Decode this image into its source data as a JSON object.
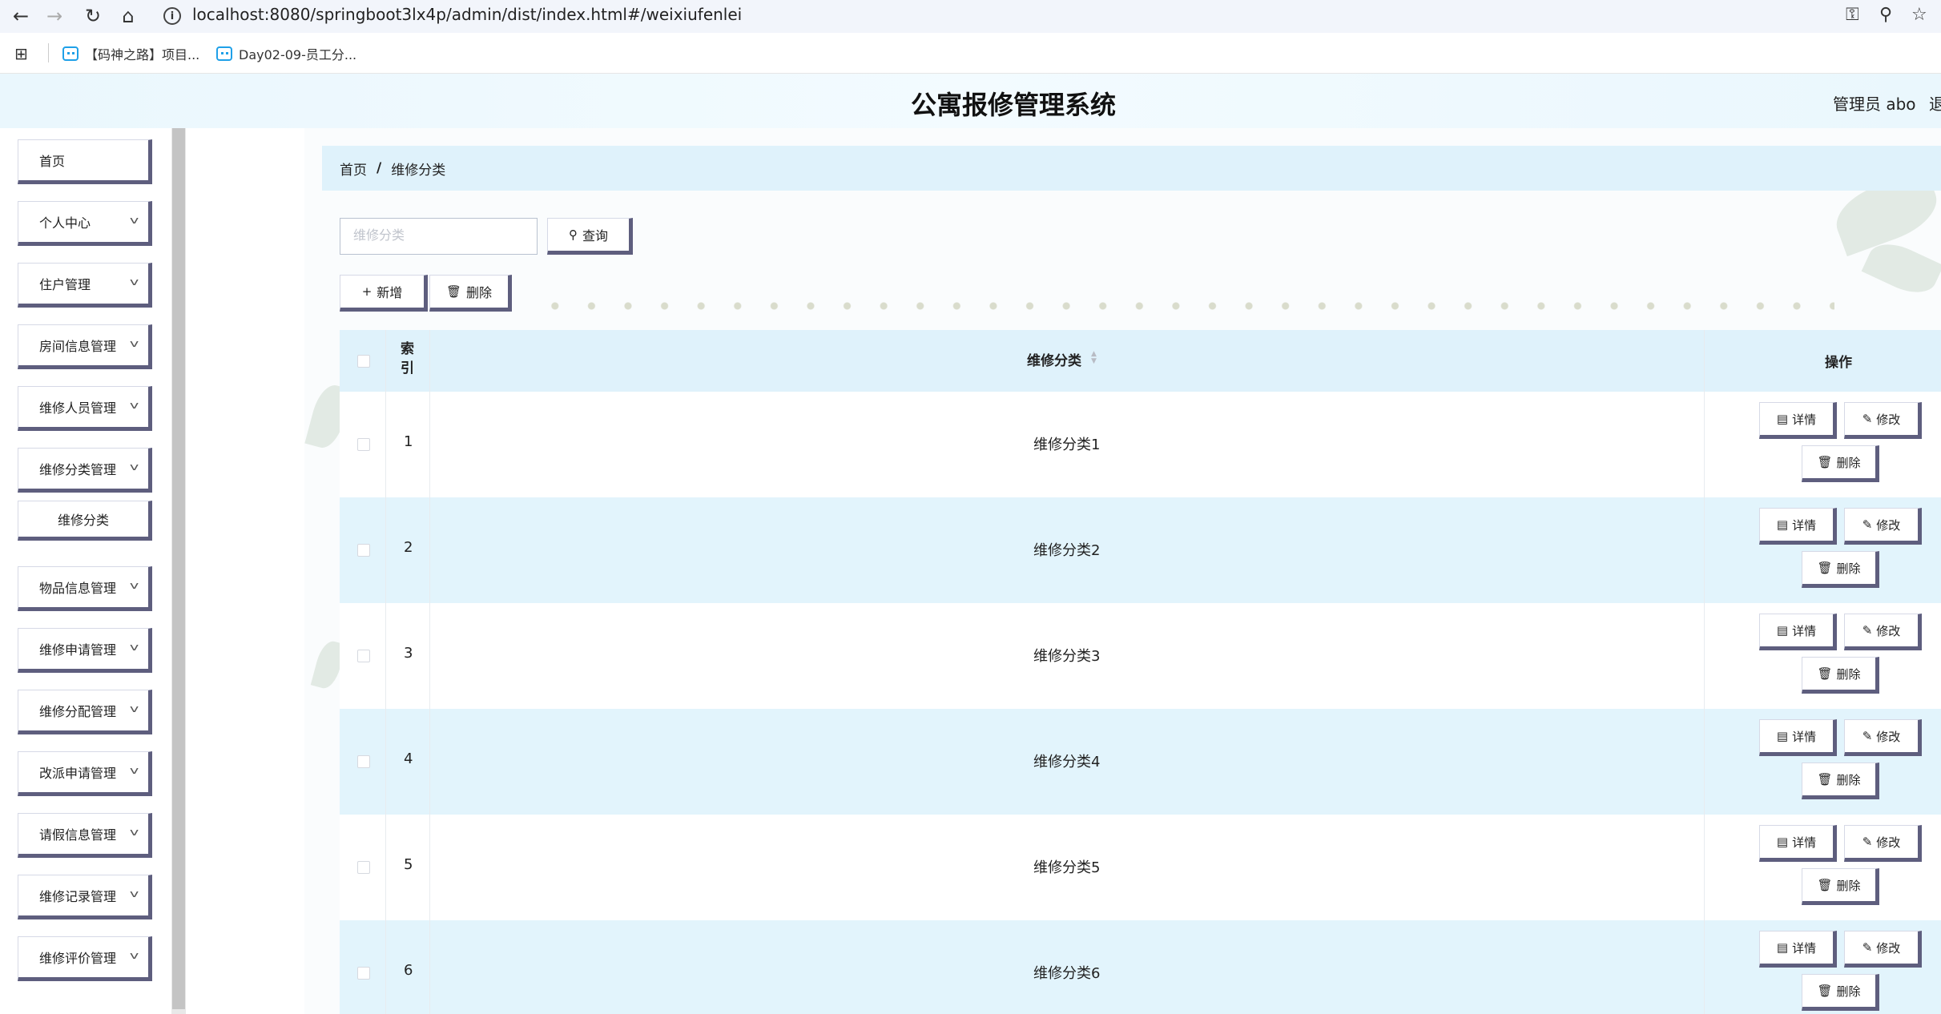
{
  "browser": {
    "url": "localhost:8080/springboot3lx4p/admin/dist/index.html#/weixiufenlei",
    "bookmarks": [
      {
        "label": "【码神之路】项目..."
      },
      {
        "label": "Day02-09-员工分..."
      }
    ],
    "icons": [
      "back-icon",
      "forward-icon",
      "reload-icon",
      "home-icon",
      "info-icon",
      "key-icon",
      "zoom-icon",
      "star-icon",
      "apps-icon"
    ]
  },
  "header": {
    "title": "公寓报修管理系统",
    "user": "管理员 abo",
    "logout": "退"
  },
  "sidebar": {
    "items": [
      {
        "label": "首页",
        "has_children": false
      },
      {
        "label": "个人中心",
        "has_children": true
      },
      {
        "label": "住户管理",
        "has_children": true
      },
      {
        "label": "房间信息管理",
        "has_children": true
      },
      {
        "label": "维修人员管理",
        "has_children": true
      },
      {
        "label": "维修分类管理",
        "has_children": true,
        "expanded": true
      },
      {
        "label": "物品信息管理",
        "has_children": true
      },
      {
        "label": "维修申请管理",
        "has_children": true
      },
      {
        "label": "维修分配管理",
        "has_children": true
      },
      {
        "label": "改派申请管理",
        "has_children": true
      },
      {
        "label": "请假信息管理",
        "has_children": true
      },
      {
        "label": "维修记录管理",
        "has_children": true
      },
      {
        "label": "维修评价管理",
        "has_children": true
      }
    ],
    "submenu_item": "维修分类"
  },
  "breadcrumb": {
    "home": "首页",
    "separator": "/",
    "current": "维修分类"
  },
  "search": {
    "placeholder": "维修分类",
    "value": "",
    "button": "查询"
  },
  "toolbar": {
    "add": "新增",
    "delete": "删除"
  },
  "table": {
    "headers": {
      "index": "索引",
      "category": "维修分类",
      "actions": "操作"
    },
    "rows": [
      {
        "index": "1",
        "category": "维修分类1"
      },
      {
        "index": "2",
        "category": "维修分类2"
      },
      {
        "index": "3",
        "category": "维修分类3"
      },
      {
        "index": "4",
        "category": "维修分类4"
      },
      {
        "index": "5",
        "category": "维修分类5"
      },
      {
        "index": "6",
        "category": "维修分类6"
      }
    ],
    "row_actions": {
      "detail": "详情",
      "edit": "修改",
      "delete": "删除"
    }
  },
  "colors": {
    "header_bg": "#eaf7fd",
    "breadcrumb_bg": "#dff2fb",
    "row_alt": "#e2f4fc",
    "button_shadow": "#5e5e7e"
  }
}
